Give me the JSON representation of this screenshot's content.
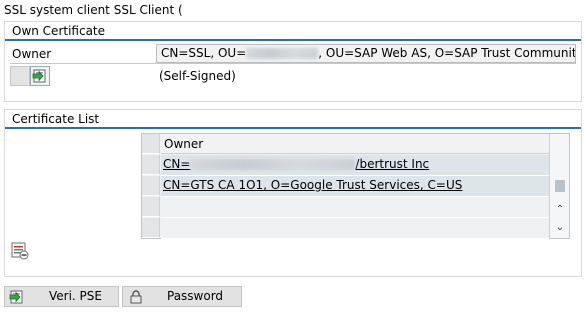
{
  "window": {
    "title": "SSL system client SSL Client ("
  },
  "own_certificate": {
    "header": "Own Certificate",
    "owner_label": "Owner",
    "owner_value_prefix": "CN=SSL, OU=",
    "owner_value_suffix": ", OU=SAP Web AS, O=SAP Trust Community,",
    "self_signed": "(Self-Signed)"
  },
  "certificate_list": {
    "header": "Certificate List",
    "column_owner": "Owner",
    "rows": [
      {
        "prefix": "CN=",
        "suffix": "/bertrust Inc"
      },
      {
        "prefix": "CN=GTS CA 1O1, O=Google Trust Services, C=US",
        "suffix": ""
      }
    ]
  },
  "buttons": {
    "veri_pse": "Veri. PSE",
    "password": "Password"
  },
  "icons": {
    "own_cert_action": "import-icon",
    "list_action": "list-detail-icon",
    "veri_pse": "verify-pse-icon",
    "password": "lock-icon"
  },
  "colors": {
    "header_underline": "#2a6fad",
    "selected_row": "#dde4ea",
    "button_bg": "#e2e2e2"
  }
}
